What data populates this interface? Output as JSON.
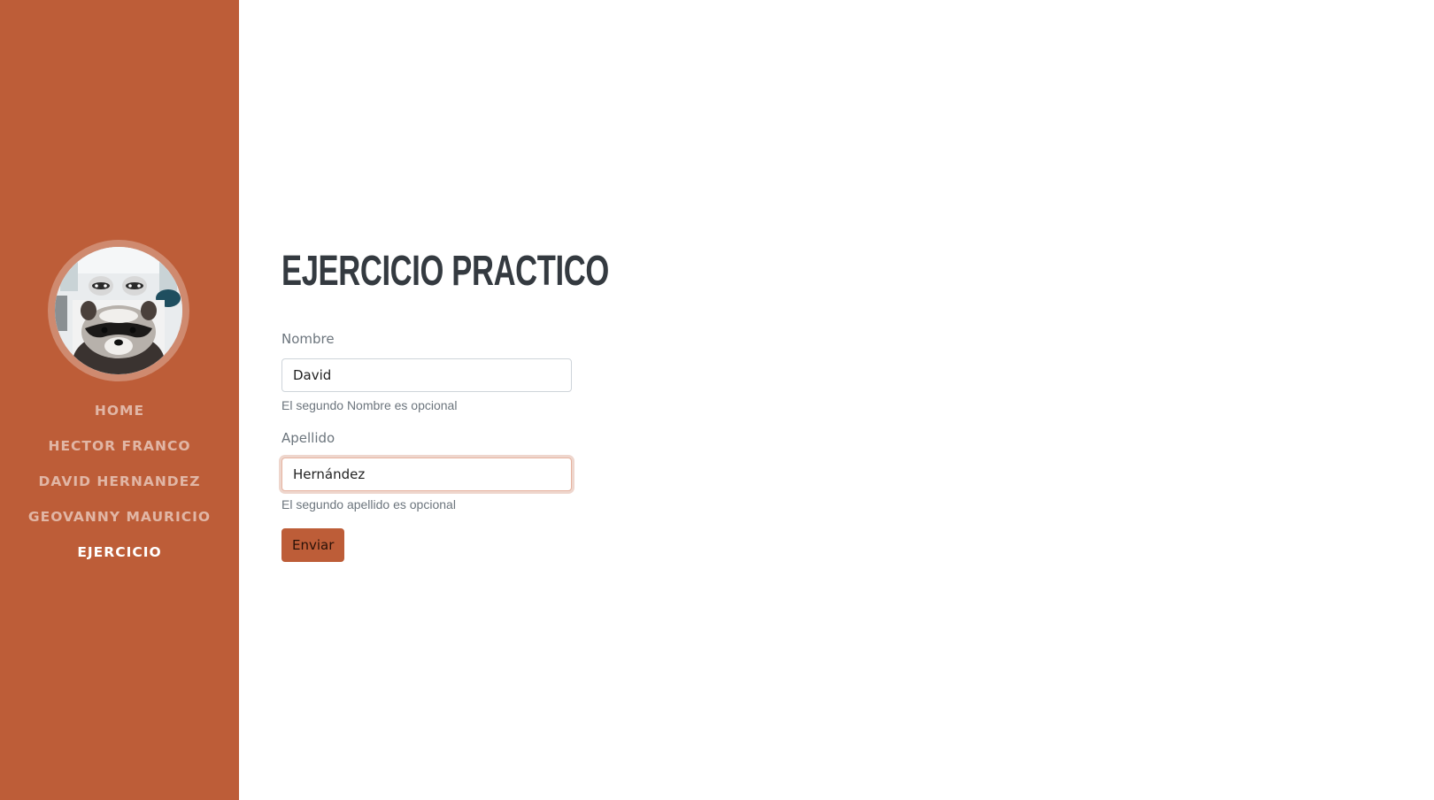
{
  "sidebar": {
    "nav": [
      "HOME",
      "HECTOR FRANCO",
      "DAVID HERNANDEZ",
      "GEOVANNY MAURICIO",
      "EJERCICIO"
    ],
    "active": "EJERCICIO",
    "avatar_icon": "raccoon-photo-icon"
  },
  "main": {
    "title": "EJERCICIO PRACTICO",
    "nombre_label": "Nombre",
    "nombre_value": "David",
    "nombre_help": "El segundo Nombre es opcional",
    "apellido_label": "Apellido",
    "apellido_value": "Hernández",
    "apellido_help": "El segundo apellido es opcional",
    "submit_label": "Enviar"
  },
  "colors": {
    "brand": "#bd5d38",
    "title": "#343a40",
    "muted": "#6c757d"
  }
}
